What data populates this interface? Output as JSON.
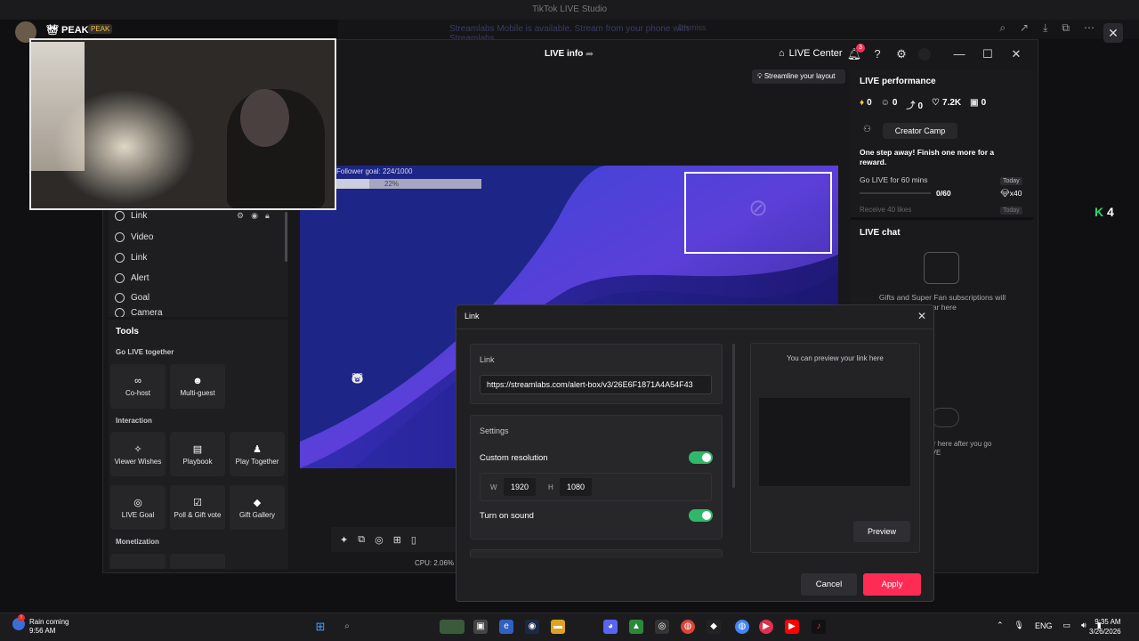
{
  "browser": {
    "tab_title": "TikTok LIVE Studio",
    "banner": "Streamlabs Mobile is available. Stream from your phone with Streamlabs.",
    "banner_button": "Dismiss",
    "icons": [
      "zoom-icon",
      "share-icon",
      "download-icon",
      "open-external-icon",
      "more-icon"
    ]
  },
  "app": {
    "title": "LIVE info",
    "live_center": "LIVE Center",
    "notif_count": "3",
    "streamline": "Streamline your layout"
  },
  "webcam": {
    "user_label": "PEAK",
    "badge": "PEAK"
  },
  "sources": {
    "items": [
      {
        "icon": "globe-icon",
        "label": "Link"
      },
      {
        "icon": "play-icon",
        "label": "Video"
      },
      {
        "icon": "globe-icon",
        "label": "Link"
      },
      {
        "icon": "bell-icon",
        "label": "Alert"
      },
      {
        "icon": "shield-icon",
        "label": "Goal"
      },
      {
        "icon": "camera-icon",
        "label": "Camera"
      }
    ]
  },
  "tools": {
    "title": "Tools",
    "sections": [
      {
        "name": "Go LIVE together",
        "buttons": [
          {
            "icon": "link-icon",
            "label": "Co-host"
          },
          {
            "icon": "people-icon",
            "label": "Multi-guest"
          }
        ]
      },
      {
        "name": "Interaction",
        "buttons": [
          {
            "icon": "viewer-wishes-icon",
            "label": "Viewer Wishes"
          },
          {
            "icon": "playbook-icon",
            "label": "Playbook"
          },
          {
            "icon": "play-together-icon",
            "label": "Play Together"
          },
          {
            "icon": "target-icon",
            "label": "LIVE Goal"
          },
          {
            "icon": "poll-icon",
            "label": "Poll & Gift vote"
          },
          {
            "icon": "gift-gallery-icon",
            "label": "Gift Gallery"
          }
        ]
      },
      {
        "name": "Monetization",
        "buttons": []
      }
    ]
  },
  "canvas": {
    "goal_label": "Follower goal: 224/1000",
    "goal_pct": "22%",
    "goal_fraction": 0.224,
    "cpu": "CPU: 2.06%"
  },
  "performance": {
    "title": "LIVE performance",
    "stats": [
      {
        "icon": "diamond-icon",
        "value": "0"
      },
      {
        "icon": "viewers-icon",
        "value": "0"
      },
      {
        "icon": "share-icon",
        "value": "0"
      },
      {
        "icon": "heart-icon",
        "value": "7.2K"
      },
      {
        "icon": "gift-icon",
        "value": "0"
      }
    ],
    "creator_camp": "Creator Camp",
    "step_text": "One step away! Finish one more for a reward.",
    "task1": "Go LIVE for 60 mins",
    "task1_progress": "0/60",
    "task1_reward": "x40",
    "today": "Today",
    "task2": "Receive 40 likes"
  },
  "chat": {
    "title": "LIVE chat",
    "empty_line1": "Gifts and Super Fan subscriptions will",
    "empty_line2": "ear here",
    "empty_line3": "ear here after you go",
    "empty_line4": "LIVE"
  },
  "dialog": {
    "title": "Link",
    "link_section": "Link",
    "url": "https://streamlabs.com/alert-box/v3/26E6F1871A4A54F43",
    "settings_section": "Settings",
    "custom_resolution": "Custom resolution",
    "w_label": "W",
    "width": "1920",
    "h_label": "H",
    "height": "1080",
    "sound": "Turn on sound",
    "preview_hint": "You can preview your link here",
    "preview_button": "Preview",
    "cancel": "Cancel",
    "apply": "Apply"
  },
  "taskbar": {
    "weather_title": "Rain coming",
    "weather_time": "9:56 AM",
    "lang": "ENG",
    "time": "9:35 AM",
    "date": "3/26/2026"
  },
  "side_badge": "4",
  "colors": {
    "accent": "#fe2c55",
    "toggle_on": "#2fb86b",
    "canvas_blue": "#1a2278"
  }
}
